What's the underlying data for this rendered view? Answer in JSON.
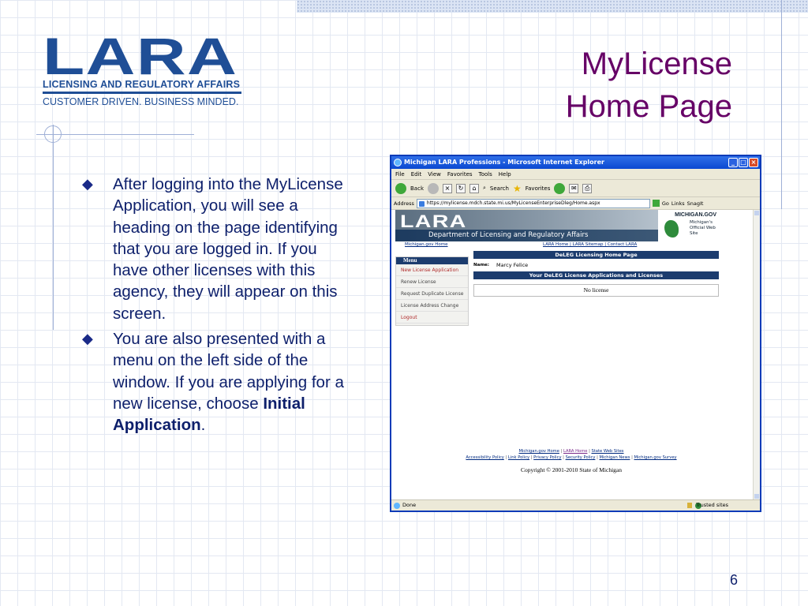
{
  "logo": {
    "wordmark": "LARA",
    "line1": "LICENSING AND REGULATORY AFFAIRS",
    "line2": "CUSTOMER DRIVEN. BUSINESS MINDED."
  },
  "title": {
    "line1": "MyLicense",
    "line2": "Home Page"
  },
  "bullets": [
    {
      "text": "After logging into the MyLicense Application, you will see a heading on the page identifying that you are logged in. If you have other licenses with this agency, they will appear on this screen."
    },
    {
      "text_before": "You are also presented with a menu on the left side of the window.  If you are applying for a new license, choose ",
      "bold": "Initial Application",
      "text_after": "."
    }
  ],
  "page_number": "6",
  "colors": {
    "title": "#660066",
    "bullet_text": "#0d1f6b",
    "logo_blue": "#1f4e96",
    "browser_frame": "#0a3bb8",
    "portal_navy": "#1c3c6e"
  },
  "browser": {
    "window_title": "Michigan LARA Professions - Microsoft Internet Explorer",
    "menubar": [
      "File",
      "Edit",
      "View",
      "Favorites",
      "Tools",
      "Help"
    ],
    "toolbar": {
      "back": "Back",
      "search": "Search",
      "favorites": "Favorites"
    },
    "address_label": "Address",
    "address_url": "https://mylicense.mdch.state.mi.us/MyLicenseEnterpriseDleg/Home.aspx",
    "go": "Go",
    "links": "Links",
    "snagit": "SnagIt",
    "status_left": "Done",
    "status_right": "Trusted sites",
    "page": {
      "banner_wordmark": "LARA",
      "banner_department": "Department of Licensing and Regulatory Affairs",
      "badge_title": "MICHIGAN.GOV",
      "badge_subtitle": "Michigan's Official Web Site",
      "link_michigan_home": "Michigan.gov Home",
      "link_group_right": "LARA Home | LARA Sitemap | Contact LARA",
      "menu_title": "Menu",
      "menu_items": [
        {
          "label": "New License Application"
        },
        {
          "label": "Renew License"
        },
        {
          "label": "Request Duplicate License"
        },
        {
          "label": "License Address Change"
        },
        {
          "label": "Logout"
        }
      ],
      "home_bar": "DeLEG Licensing Home Page",
      "name_label": "Name:",
      "name_value": "Marcy Felice",
      "applications_bar": "Your DeLEG License Applications and Licenses",
      "no_license": "No license",
      "footer_row1": [
        "Michigan.gov Home",
        "LARA Home",
        "State Web Sites"
      ],
      "footer_row2": [
        "Accessibility Policy",
        "Link Policy",
        "Privacy Policy",
        "Security Policy",
        "Michigan News",
        "Michigan.gov Survey"
      ],
      "copyright": "Copyright © 2001-2010 State of Michigan"
    }
  }
}
